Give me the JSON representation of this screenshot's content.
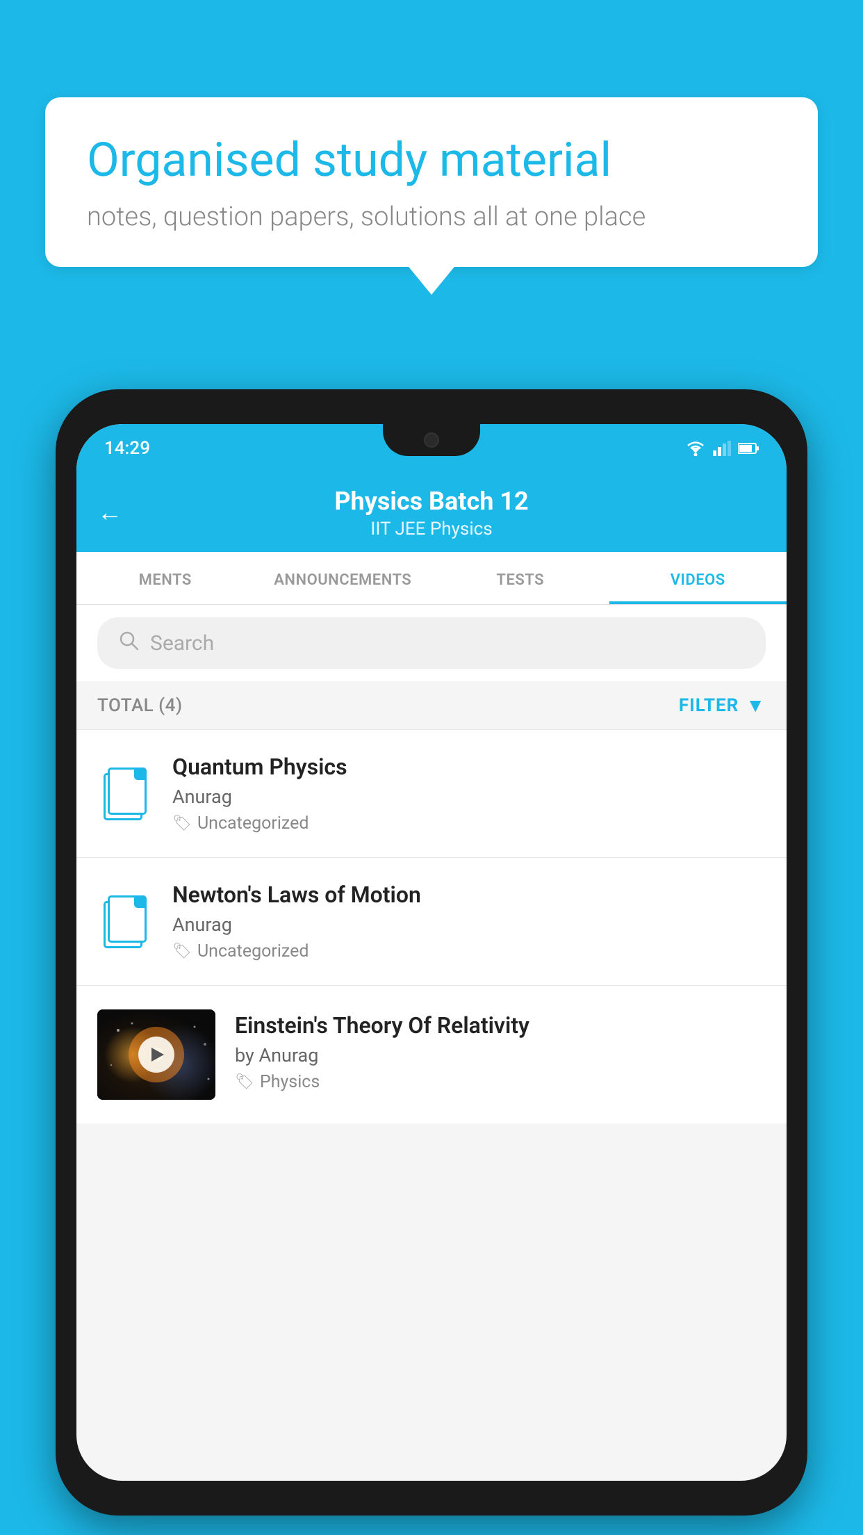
{
  "background_color": "#1cb9e8",
  "speech_bubble": {
    "title": "Organised study material",
    "subtitle": "notes, question papers, solutions all at one place"
  },
  "phone": {
    "status_bar": {
      "time": "14:29"
    },
    "header": {
      "title": "Physics Batch 12",
      "subtitle": "IIT JEE    Physics",
      "back_label": "←"
    },
    "tabs": [
      {
        "label": "MENTS",
        "active": false
      },
      {
        "label": "ANNOUNCEMENTS",
        "active": false
      },
      {
        "label": "TESTS",
        "active": false
      },
      {
        "label": "VIDEOS",
        "active": true
      }
    ],
    "search": {
      "placeholder": "Search"
    },
    "filter_bar": {
      "total_label": "TOTAL (4)",
      "filter_label": "FILTER"
    },
    "videos": [
      {
        "title": "Quantum Physics",
        "author": "Anurag",
        "tag": "Uncategorized",
        "has_thumbnail": false
      },
      {
        "title": "Newton's Laws of Motion",
        "author": "Anurag",
        "tag": "Uncategorized",
        "has_thumbnail": false
      },
      {
        "title": "Einstein's Theory Of Relativity",
        "author": "by Anurag",
        "tag": "Physics",
        "has_thumbnail": true
      }
    ]
  }
}
